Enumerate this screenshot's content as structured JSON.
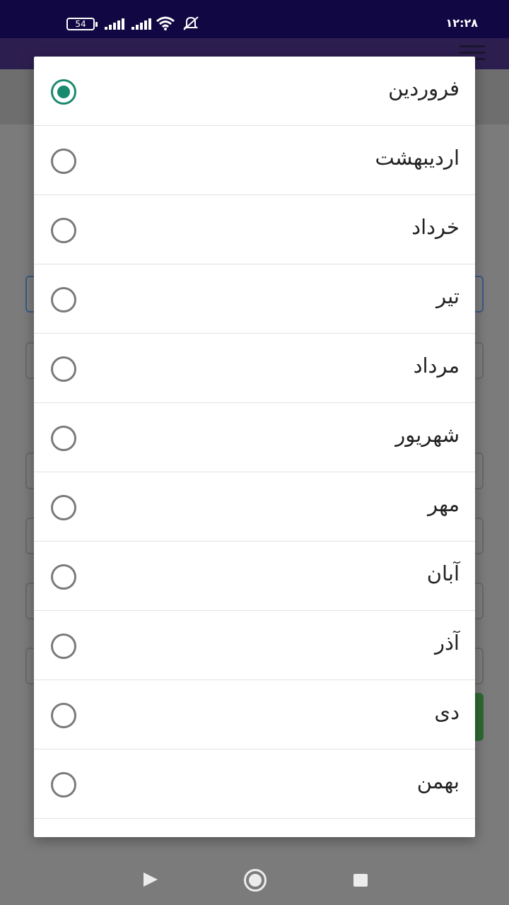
{
  "status_bar": {
    "battery": "54",
    "time": "۱۲:۲۸"
  },
  "month_dialog": {
    "selected_index": 0,
    "options": [
      {
        "label": "فروردین",
        "checked": true
      },
      {
        "label": "اردیبهشت",
        "checked": false
      },
      {
        "label": "خرداد",
        "checked": false
      },
      {
        "label": "تیر",
        "checked": false
      },
      {
        "label": "مرداد",
        "checked": false
      },
      {
        "label": "شهریور",
        "checked": false
      },
      {
        "label": "مهر",
        "checked": false
      },
      {
        "label": "آبان",
        "checked": false
      },
      {
        "label": "آذر",
        "checked": false
      },
      {
        "label": "دی",
        "checked": false
      },
      {
        "label": "بهمن",
        "checked": false
      }
    ]
  },
  "colors": {
    "status_bar": "#110742",
    "app_bar": "#2d1e50",
    "radio_selected": "#1a8a6e",
    "radio_unselected": "#7a7a7a"
  }
}
